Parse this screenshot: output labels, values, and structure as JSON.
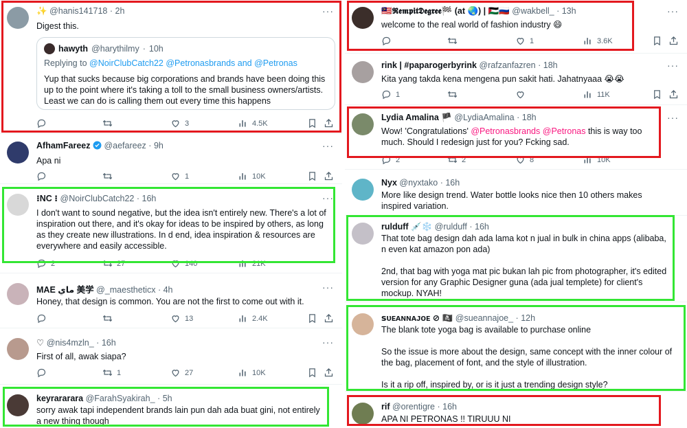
{
  "colors": {
    "red_box": "#e3181e",
    "green_box": "#33e633",
    "mention": "#f91880",
    "link": "#1d9bf0",
    "meta": "#536471"
  },
  "left": [
    {
      "name": "✨",
      "handle": "@hanis141718",
      "time": "2h",
      "text": [
        "Digest this."
      ],
      "quote": {
        "name": "hawyth",
        "handle": "@harythilmy",
        "time": "10h",
        "replying": "Replying to ",
        "replying_to": "@NoirClubCatch22 @Petronasbrands and @Petronas",
        "text": "Yup that sucks because big corporations and brands have been doing this up to the point where it's taking a toll to the small business owners/artists. Least we can do is calling them out every time this happens"
      },
      "replies": "",
      "retweets": "",
      "likes": "3",
      "views": "4.5K"
    },
    {
      "name": "AfhamFareez",
      "handle": "@aefareez",
      "time": "9h",
      "text": [
        "Apa ni"
      ],
      "replies": "",
      "retweets": "",
      "likes": "1",
      "views": "10K"
    },
    {
      "name": "⁝NC ⁝",
      "handle": "@NoirClubCatch22",
      "time": "16h",
      "text": [
        "I don't want to sound negative, but the idea isn't entirely new. There's a lot of inspiration out there, and it's okay for ideas to be inspired by others, as long as they create new illustrations. In d end, idea inspiration & resources are everywhere and easily accessible."
      ],
      "replies": "2",
      "retweets": "27",
      "likes": "140",
      "views": "21K"
    },
    {
      "name": "MAE ماي 美学",
      "handle": "@_maestheticx",
      "time": "4h",
      "text": [
        "Honey, that design is common. You are not the first to come out with it."
      ],
      "replies": "",
      "retweets": "",
      "likes": "13",
      "views": "2.4K"
    },
    {
      "name": "♡",
      "handle": "@nis4mzln_",
      "time": "16h",
      "text": [
        "First of all, awak siapa?"
      ],
      "replies": "",
      "retweets": "1",
      "likes": "27",
      "views": "10K"
    },
    {
      "name": "keyrararara",
      "handle": "@FarahSyakirah_",
      "time": "5h",
      "text": [
        "sorry awak tapi independent brands lain pun dah ada buat gini, not entirely a new thing though"
      ]
    }
  ],
  "right": [
    {
      "name": "🇲🇾𝕽𝖊𝖒𝖕𝖎𝖙𝕯𝖊𝖌𝖗𝖊𝖊🏁 (at 🌏) | 🇵🇸🇷🇺",
      "handle": "@wakbell_",
      "time": "13h",
      "text": [
        "welcome to the real world of fashion industry 😄"
      ],
      "replies": "",
      "retweets": "",
      "likes": "1",
      "views": "3.6K"
    },
    {
      "name": "rink | #paparogerbyrink",
      "handle": "@rafzanfazren",
      "time": "18h",
      "text": [
        "Kita yang takda kena mengena pun sakit hati. Jahatnyaaa 😭😭"
      ],
      "replies": "1",
      "retweets": "",
      "likes": "",
      "views": "11K"
    },
    {
      "name": "Lydia Amalina 🏴",
      "handle": "@LydiaAmalina",
      "time": "18h",
      "text_pre": "Wow! 'Congratulations' ",
      "m1": "@Petronasbrands",
      "m2": "@Petronas",
      "text_post": " this is way too much. Should I redesign just for you? Fcking sad.",
      "replies": "2",
      "retweets": "2",
      "likes": "8",
      "views": "10K"
    },
    {
      "name": "Nyx",
      "handle": "@nyxtako",
      "time": "16h",
      "text": [
        "More like design trend. Water bottle looks nice then 10 others makes inspired variation."
      ]
    },
    {
      "name": "rulduff 💉❄️",
      "handle": "@rulduff",
      "time": "16h",
      "text": [
        "That tote bag design dah ada lama kot n jual in bulk in china apps (alibaba, n even kat amazon pon ada)",
        "2nd, that bag with yoga mat pic bukan lah pic from photographer, it's edited version for any Graphic Designer guna (ada jual templete) for client's mockup. NYAH!"
      ]
    },
    {
      "name": "ꜱᴜᴇᴀɴɴᴀᴊᴏᴇ ⊘ 🏴‍☠️",
      "handle": "@sueannajoe_",
      "time": "12h",
      "text": [
        "The blank tote yoga bag is available to purchase online",
        "So the issue is more about the design, same concept with the inner colour of the bag, placement of font, and the style of illustration.",
        "Is it a rip off, inspired by, or is it just a trending design style?"
      ]
    },
    {
      "name": "rif",
      "handle": "@orentigre",
      "time": "16h",
      "text": [
        "APA NI PETRONAS !! TIRUUU NI"
      ]
    }
  ]
}
